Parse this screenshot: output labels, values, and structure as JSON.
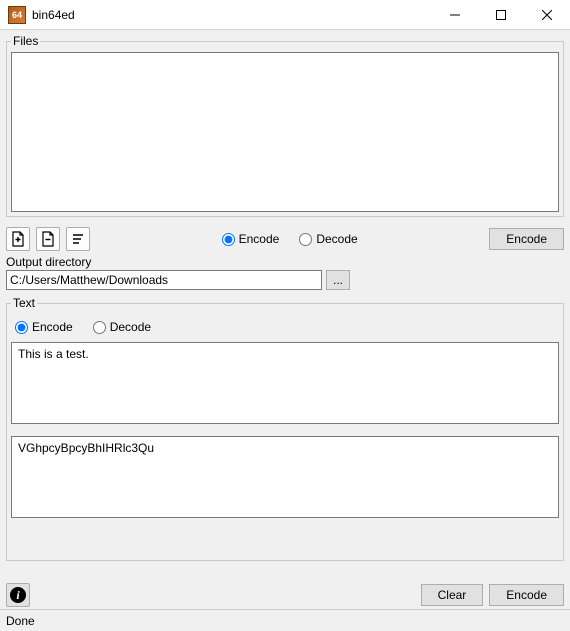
{
  "window": {
    "title": "bin64ed",
    "icon_text": "64"
  },
  "files_section": {
    "legend": "Files",
    "encode_label": "Encode",
    "decode_label": "Decode",
    "action_button": "Encode"
  },
  "output_dir": {
    "label": "Output directory",
    "value": "C:/Users/Matthew/Downloads",
    "browse": "..."
  },
  "text_section": {
    "legend": "Text",
    "encode_label": "Encode",
    "decode_label": "Decode",
    "input_value": "This is a test.",
    "output_value": "VGhpcyBpcyBhIHRlc3Qu"
  },
  "bottom": {
    "info_glyph": "i",
    "clear": "Clear",
    "encode": "Encode"
  },
  "status": {
    "text": "Done"
  }
}
